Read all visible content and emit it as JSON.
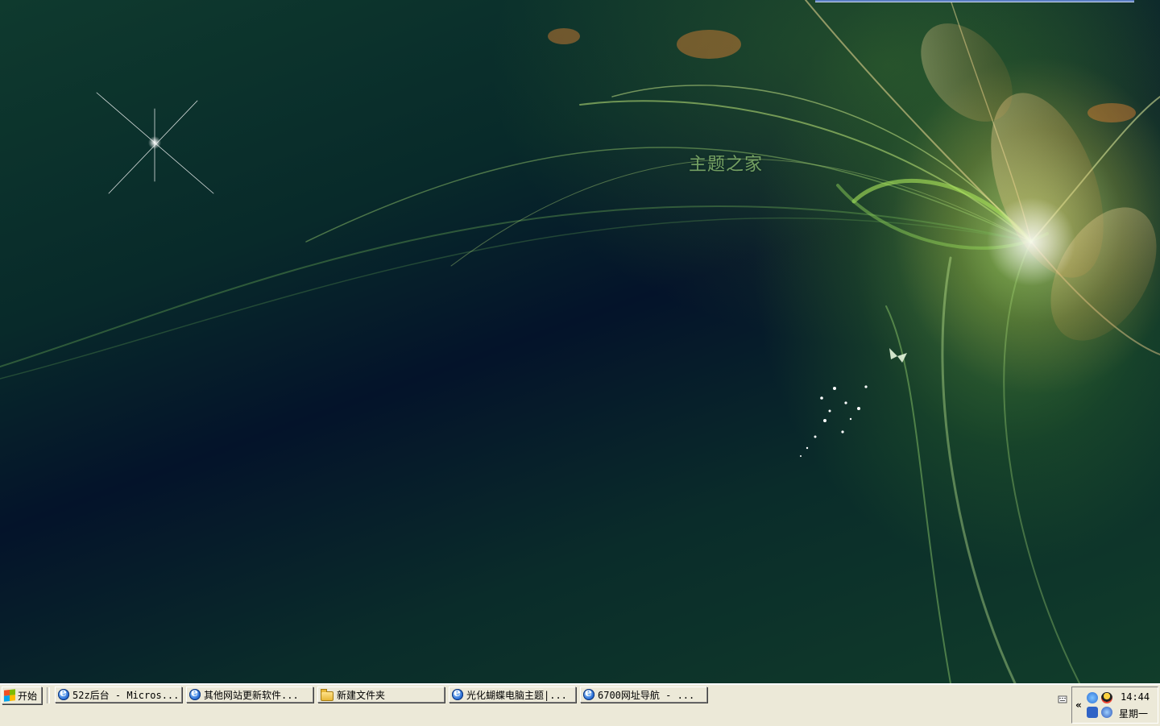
{
  "desktop": {
    "watermark_text": "主题之家",
    "colors": {
      "deep": "#04132a",
      "green": "#3f8a35",
      "glow": "#fff0b4"
    }
  },
  "taskbar": {
    "start_label": "开始",
    "tasks": [
      {
        "label": "52z后台 - Micros...",
        "icon": "ie-icon"
      },
      {
        "label": "其他网站更新软件...",
        "icon": "ie-icon"
      },
      {
        "label": "新建文件夹",
        "icon": "folder-icon"
      },
      {
        "label": "光化蝴蝶电脑主题|...",
        "icon": "ie-icon"
      },
      {
        "label": "6700网址导航 - ...",
        "icon": "ie-icon"
      }
    ],
    "tray": {
      "chevron": "«",
      "time": "14:44",
      "day": "星期一",
      "icons": [
        "network-icon",
        "qq-icon",
        "back-arrow-icon",
        "security-icon"
      ]
    }
  }
}
